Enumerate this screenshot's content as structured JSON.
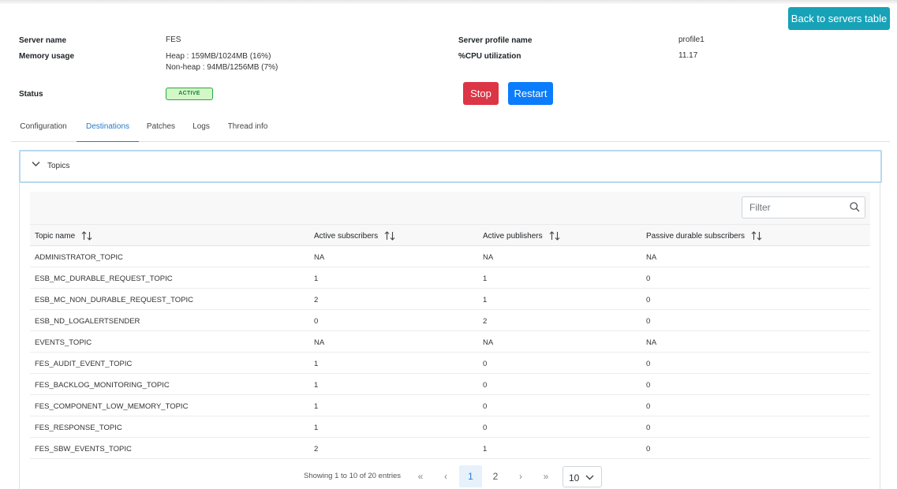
{
  "header": {
    "back_button": "Back to servers table"
  },
  "server": {
    "name_label": "Server name",
    "name_value": "FES",
    "memory_label": "Memory usage",
    "memory_heap": "Heap : 159MB/1024MB (16%)",
    "memory_nonheap": "Non-heap : 94MB/1256MB (7%)",
    "status_label": "Status",
    "status_value": "ACTIVE",
    "profile_label": "Server profile name",
    "profile_value": "profile1",
    "cpu_label": "%CPU utilization",
    "cpu_value": "11.17"
  },
  "actions": {
    "stop": "Stop",
    "restart": "Restart"
  },
  "tabs": [
    {
      "label": "Configuration",
      "active": false
    },
    {
      "label": "Destinations",
      "active": true
    },
    {
      "label": "Patches",
      "active": false
    },
    {
      "label": "Logs",
      "active": false
    },
    {
      "label": "Thread info",
      "active": false
    }
  ],
  "accordion": {
    "title": "Topics"
  },
  "filter": {
    "placeholder": "Filter"
  },
  "table": {
    "columns": [
      "Topic name",
      "Active subscribers",
      "Active publishers",
      "Passive durable subscribers"
    ],
    "rows": [
      [
        "ADMINISTRATOR_TOPIC",
        "NA",
        "NA",
        "NA"
      ],
      [
        "ESB_MC_DURABLE_REQUEST_TOPIC",
        "1",
        "1",
        "0"
      ],
      [
        "ESB_MC_NON_DURABLE_REQUEST_TOPIC",
        "2",
        "1",
        "0"
      ],
      [
        "ESB_ND_LOGALERTSENDER",
        "0",
        "2",
        "0"
      ],
      [
        "EVENTS_TOPIC",
        "NA",
        "NA",
        "NA"
      ],
      [
        "FES_AUDIT_EVENT_TOPIC",
        "1",
        "0",
        "0"
      ],
      [
        "FES_BACKLOG_MONITORING_TOPIC",
        "1",
        "0",
        "0"
      ],
      [
        "FES_COMPONENT_LOW_MEMORY_TOPIC",
        "1",
        "0",
        "0"
      ],
      [
        "FES_RESPONSE_TOPIC",
        "1",
        "0",
        "0"
      ],
      [
        "FES_SBW_EVENTS_TOPIC",
        "2",
        "1",
        "0"
      ]
    ]
  },
  "pagination": {
    "showing": "Showing 1 to 10 of 20 entries",
    "first": "«",
    "prev": "‹",
    "pages": [
      "1",
      "2"
    ],
    "next": "›",
    "last": "»",
    "page_size": "10"
  },
  "colors": {
    "accent": "#17a2b8",
    "stop": "#dc3545",
    "restart": "#0b7cfb",
    "active_tab": "#2a7ac7",
    "status_bg": "#d4f7c8"
  }
}
